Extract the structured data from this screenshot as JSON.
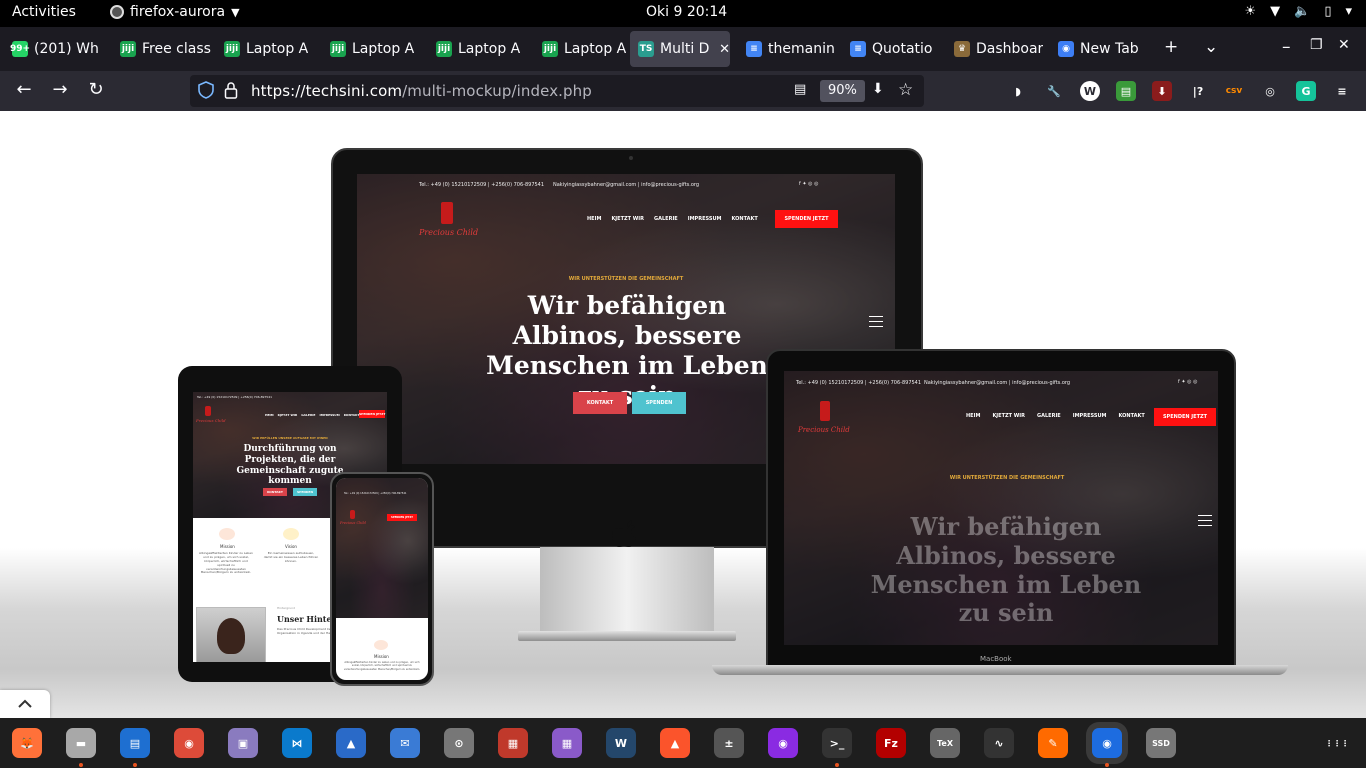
{
  "topbar": {
    "activities": "Activities",
    "app_name": "firefox-aurora",
    "clock": "Oki 9  20:14",
    "tray_icons": [
      "brightness-icon",
      "wifi-icon",
      "volume-icon",
      "battery-icon",
      "power-icon"
    ]
  },
  "tabs": [
    {
      "label": "(201) Wh",
      "icon": "whatsapp-icon",
      "color": "#25d366",
      "badge": "99+"
    },
    {
      "label": "Free class",
      "icon": "jiji-icon",
      "color": "#19a34f",
      "badge": "jiji"
    },
    {
      "label": "Laptop A",
      "icon": "jiji-icon",
      "color": "#19a34f",
      "badge": "jiji"
    },
    {
      "label": "Laptop A",
      "icon": "jiji-icon",
      "color": "#19a34f",
      "badge": "jiji"
    },
    {
      "label": "Laptop A",
      "icon": "jiji-icon",
      "color": "#19a34f",
      "badge": "jiji"
    },
    {
      "label": "Laptop A",
      "icon": "jiji-icon",
      "color": "#19a34f",
      "badge": "jiji"
    },
    {
      "label": "Multi D",
      "icon": "techsini-icon",
      "color": "#2a9d8f",
      "badge": "TS",
      "active": true
    },
    {
      "label": "themanin",
      "icon": "docs-icon",
      "color": "#4285f4",
      "badge": "≡"
    },
    {
      "label": "Quotatio",
      "icon": "docs-icon",
      "color": "#4285f4",
      "badge": "≡"
    },
    {
      "label": "Dashboar",
      "icon": "dashboard-icon",
      "color": "#8a6a3a",
      "badge": "♛"
    },
    {
      "label": "New Tab",
      "icon": "firefox-icon",
      "color": "#3d7ef5",
      "badge": "◉"
    }
  ],
  "tabbar_controls": {
    "new_tab": "+",
    "list_tabs": "⌄",
    "minimize": "–",
    "maximize": "❐",
    "close": "✕"
  },
  "nav": {
    "back": "←",
    "forward": "→",
    "reload": "↻",
    "url_host": "https://techsini.com",
    "url_path": "/multi-mockup/index.php",
    "zoom": "90%"
  },
  "extensions": [
    {
      "name": "pocket-icon",
      "glyph": "◗",
      "color": "#2b2a33"
    },
    {
      "name": "wrench-icon",
      "glyph": "🔧",
      "color": "#2b2a33"
    },
    {
      "name": "wordpress-icon",
      "glyph": "W",
      "color": "#2b2a33"
    },
    {
      "name": "ext-green-icon",
      "glyph": "▤",
      "color": "#3a9a3a"
    },
    {
      "name": "download-icon",
      "glyph": "⬇",
      "color": "#8a1c1c"
    },
    {
      "name": "ext-yellow-icon",
      "glyph": "|?",
      "color": "#2b2a33"
    },
    {
      "name": "csv-icon",
      "glyph": "csv",
      "color": "#2b2a33"
    },
    {
      "name": "colorpicker-icon",
      "glyph": "◎",
      "color": "#2b2a33"
    },
    {
      "name": "grammarly-icon",
      "glyph": "G",
      "color": "#15c39a"
    },
    {
      "name": "menu-icon",
      "glyph": "≡",
      "color": "#2b2a33"
    }
  ],
  "site": {
    "topline": "Tel.: +49 (0) 15210172509 | +256(0) 706-897541",
    "email": "Nakiyingiassybahner@gmail.com | info@precious-gifts.org",
    "logo": "Precious Child",
    "nav": [
      "HEIM",
      "KJETZT WIR",
      "GALERIE",
      "IMPRESSUM",
      "KONTAKT"
    ],
    "donate": "SPENDEN JETZT",
    "kicker": "WIR UNTERSTÜTZEN DIE GEMEINSCHAFT",
    "headline": "Wir befähigen Albinos, bessere Menschen im Leben zu sein",
    "btn_contact": "KONTAKT",
    "btn_donate": "SPENDEN",
    "tablet_kicker": "WIR ERFÜLLEN UNSERE AUFGABE MIT IHNEN",
    "tablet_headline": "Durchführung von Projekten, die der Gemeinschaft zugute kommen",
    "mission": "Mission",
    "vision": "Vision",
    "mission_text": "Albingeäffektierten Kinder zu Leben und zu prägen, um sich sozial, körperlich, wirtschaftlich und spirituell zu verantwortungsbewussten Menschen/Bürgern zu entwickeln.",
    "vision_text": "Ein Gemeinwesen aufzubauen, damit sie ein besseres Leben führen können.",
    "background_small": "Hintergrund",
    "background_title": "Unser Hintergr",
    "background_text": "Das Precious Child Development Center ist eine gemeinnützige Organisation in Uganda und der Hauptsitz ist in Jinja.",
    "macbook": "MacBook"
  },
  "dock": [
    {
      "name": "firefox-dock-icon",
      "color": "#ff7139",
      "glyph": "🦊",
      "running": false
    },
    {
      "name": "files-icon",
      "color": "#a8a8a8",
      "glyph": "▬",
      "running": true
    },
    {
      "name": "writer-icon",
      "color": "#1e6fd1",
      "glyph": "▤",
      "running": true
    },
    {
      "name": "chrome-icon",
      "color": "#dd4b39",
      "glyph": "◉",
      "running": false
    },
    {
      "name": "archive-icon",
      "color": "#8a7bbf",
      "glyph": "▣",
      "running": false
    },
    {
      "name": "vscode-icon",
      "color": "#0a7acc",
      "glyph": "⋈",
      "running": false
    },
    {
      "name": "shell-icon",
      "color": "#2a6ac8",
      "glyph": "▲",
      "running": false
    },
    {
      "name": "mail-icon",
      "color": "#3a7bd5",
      "glyph": "✉",
      "running": false
    },
    {
      "name": "vpn-icon",
      "color": "#777",
      "glyph": "⊙",
      "running": false
    },
    {
      "name": "presentation-icon",
      "color": "#c0392b",
      "glyph": "▦",
      "running": false
    },
    {
      "name": "video-icon",
      "color": "#8a5ac9",
      "glyph": "▦",
      "running": false
    },
    {
      "name": "wireshark-icon",
      "color": "#24476b",
      "glyph": "W",
      "running": false
    },
    {
      "name": "brave-icon",
      "color": "#fb542b",
      "glyph": "▲",
      "running": false
    },
    {
      "name": "calculator-icon",
      "color": "#555",
      "glyph": "±",
      "running": false
    },
    {
      "name": "podcast-icon",
      "color": "#8a2be2",
      "glyph": "◉",
      "running": false
    },
    {
      "name": "terminal-icon",
      "color": "#333",
      "glyph": ">_",
      "running": true
    },
    {
      "name": "filezilla-icon",
      "color": "#b30000",
      "glyph": "Fz",
      "running": false
    },
    {
      "name": "texmaker-icon",
      "color": "#666",
      "glyph": "TeX",
      "running": false
    },
    {
      "name": "monitor-icon",
      "color": "#333",
      "glyph": "∿",
      "running": false
    },
    {
      "name": "sublime-icon",
      "color": "#ff6a00",
      "glyph": "✎",
      "running": false
    },
    {
      "name": "firefox-aurora-icon",
      "color": "#1d6ce0",
      "glyph": "◉",
      "running": true,
      "active": true
    },
    {
      "name": "ssd-icon",
      "color": "#777",
      "glyph": "SSD",
      "running": false
    },
    {
      "name": "app-grid-icon",
      "color": "#1e1e1e",
      "glyph": "⋮⋮⋮",
      "running": false
    }
  ]
}
